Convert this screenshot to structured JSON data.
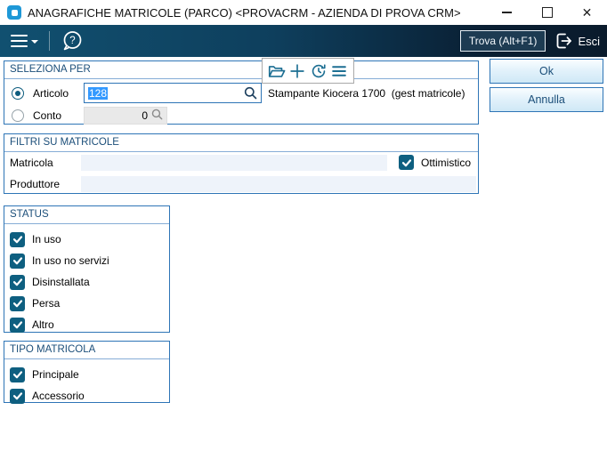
{
  "window": {
    "title": "ANAGRAFICHE MATRICOLE (PARCO) <PROVACRM - AZIENDA DI PROVA CRM>"
  },
  "toolbar": {
    "trova": "Trova (Alt+F1)",
    "esci": "Esci"
  },
  "seleziona": {
    "title": "SELEZIONA PER",
    "articolo_label": "Articolo",
    "articolo_value": "128",
    "conto_label": "Conto",
    "conto_value": "0",
    "descrizione": "Stampante Kiocera 1700  (gest matricole)"
  },
  "actions": {
    "ok": "Ok",
    "annulla": "Annulla"
  },
  "filtri": {
    "title": "FILTRI SU MATRICOLE",
    "matricola_label": "Matricola",
    "matricola_value": "",
    "produttore_label": "Produttore",
    "produttore_value": "",
    "ottimistico_label": "Ottimistico",
    "ottimistico_checked": true
  },
  "status": {
    "title": "STATUS",
    "items": [
      {
        "label": "In uso",
        "checked": true
      },
      {
        "label": "In uso no servizi",
        "checked": true
      },
      {
        "label": "Disinstallata",
        "checked": true
      },
      {
        "label": "Persa",
        "checked": true
      },
      {
        "label": "Altro",
        "checked": true
      }
    ]
  },
  "tipo": {
    "title": "TIPO MATRICOLA",
    "items": [
      {
        "label": "Principale",
        "checked": true
      },
      {
        "label": "Accessorio",
        "checked": true
      }
    ]
  },
  "icons": {
    "close": "✕",
    "minimize": "–",
    "maximize": "□",
    "hamburger": "≡",
    "caret_down": "▾",
    "help": "?",
    "folder_open": "open-folder",
    "add": "+",
    "refresh": "circular-arrow-clock",
    "list": "≡",
    "search": "magnifier",
    "exit": "door-arrow-right",
    "check": "✓"
  },
  "colors": {
    "accent_border": "#2e75b6",
    "group_title": "#1b4e79",
    "checkbox_fill": "#0e5f80",
    "toolbar_gradient_start": "#115070",
    "toolbar_gradient_end": "#0a1b2c",
    "selection_highlight": "#3399ff",
    "icon_teal": "#1d6f93",
    "app_icon_blue": "#1e98d7",
    "field_light_blue": "#eef3fa",
    "disabled_field": "#e9e9e9"
  }
}
